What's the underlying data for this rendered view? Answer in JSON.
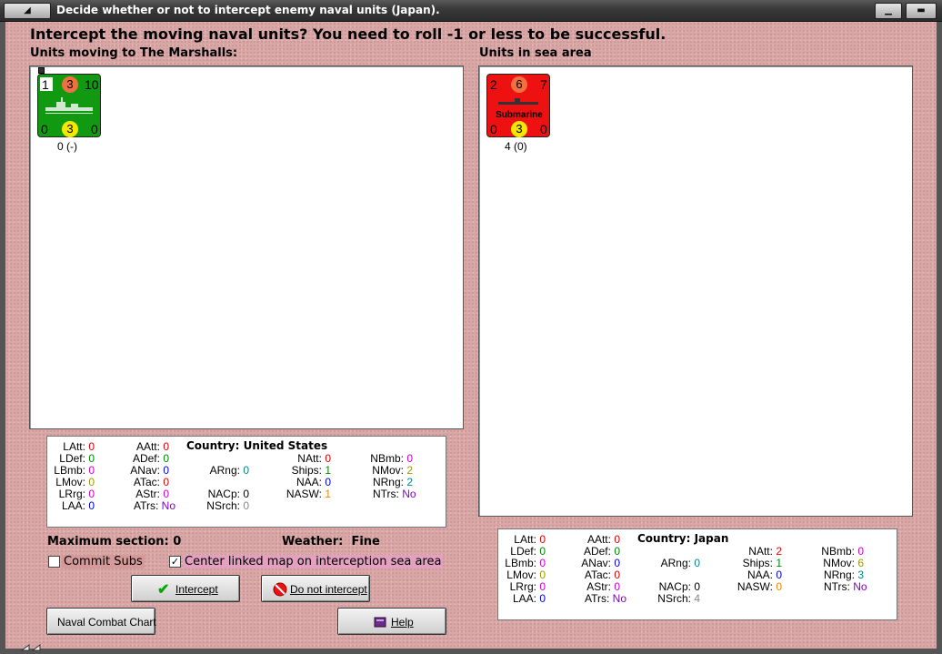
{
  "window": {
    "title": "Decide whether or not to intercept enemy naval units (Japan).",
    "headline": "Intercept the moving naval units?  You need to roll -1 or less to be successful."
  },
  "left": {
    "label": "Units moving to The Marshalls:",
    "counter": {
      "top_left": "1",
      "top_mid": "3",
      "top_right": "10",
      "bot_left": "0",
      "bot_mid": "3",
      "bot_right": "0",
      "caption": "0 (-)",
      "bg": "#119911",
      "mid_top_color": "#f07040",
      "mid_bot_color": "#f5e800"
    }
  },
  "right": {
    "label": "Units in sea area",
    "counter": {
      "top_left": "2",
      "top_mid": "6",
      "top_right": "7",
      "name": "Submarine",
      "bot_left": "0",
      "bot_mid": "3",
      "bot_right": "0",
      "caption": "4 (0)",
      "bg": "#ee1111",
      "mid_top_color": "#f07040",
      "mid_bot_color": "#f5e800"
    }
  },
  "us_stats": {
    "country": "Country: United States",
    "LAtt": "0",
    "LDef": "0",
    "LBmb": "0",
    "LMov": "0",
    "LRrg": "0",
    "LAA": "0",
    "AAtt": "0",
    "ADef": "0",
    "ANav": "0",
    "ATac": "0",
    "AStr": "0",
    "ATrs": "No",
    "ARng": "0",
    "NACp": "0",
    "NSrch": "0",
    "NAtt": "0",
    "Ships": "1",
    "NAA": "0",
    "NASW": "1",
    "NBmb": "0",
    "NMov": "2",
    "NRng": "2",
    "NTrs": "No"
  },
  "jp_stats": {
    "country": "Country: Japan",
    "LAtt": "0",
    "LDef": "0",
    "LBmb": "0",
    "LMov": "0",
    "LRrg": "0",
    "LAA": "0",
    "AAtt": "0",
    "ADef": "0",
    "ANav": "0",
    "ATac": "0",
    "AStr": "0",
    "ATrs": "No",
    "ARng": "0",
    "NACp": "0",
    "NSrch": "4",
    "NAtt": "2",
    "Ships": "1",
    "NAA": "0",
    "NASW": "0",
    "NBmb": "0",
    "NMov": "6",
    "NRng": "3",
    "NTrs": "No"
  },
  "info": {
    "max_section": "Maximum section: 0",
    "weather_label": "Weather:",
    "weather_value": "Fine"
  },
  "options": {
    "commit_subs": "Commit Subs",
    "commit_subs_checked": "",
    "center_map": "Center linked map on interception sea area",
    "center_map_checked": "✓"
  },
  "buttons": {
    "intercept": "Intercept",
    "do_not_intercept": "Do not intercept",
    "naval_chart": "Naval Combat Chart",
    "help": "Help"
  },
  "colors": {
    "red": "#dd0000",
    "green": "#008800",
    "magenta": "#cc00cc",
    "olive": "#999900",
    "blue": "#0000dd",
    "teal": "#008888",
    "orange": "#ee8800",
    "purple": "#8800cc",
    "gray": "#888888"
  }
}
